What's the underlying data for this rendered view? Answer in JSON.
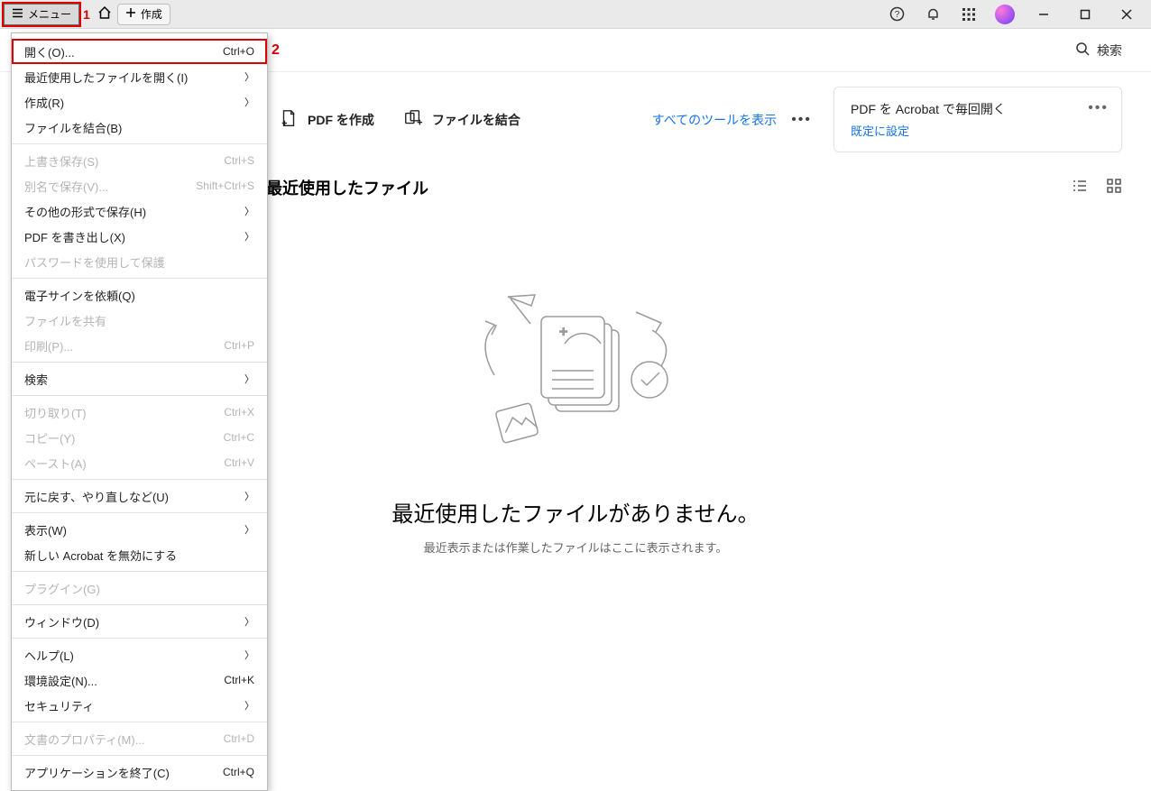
{
  "annotations": {
    "one": "1",
    "two": "2"
  },
  "titlebar": {
    "menu_label": "メニュー",
    "create_label": "作成"
  },
  "search": {
    "label": "検索"
  },
  "tools": {
    "create_pdf": "PDF を作成",
    "combine": "ファイルを結合",
    "see_all": "すべてのツールを表示"
  },
  "promo": {
    "title": "PDF を Acrobat で毎回開く",
    "action": "既定に設定"
  },
  "section": {
    "title": "最近使用したファイル"
  },
  "empty": {
    "heading": "最近使用したファイルがありません。",
    "sub": "最近表示または作業したファイルはここに表示されます。"
  },
  "menu_items": [
    {
      "label": "開く(O)...",
      "shortcut": "Ctrl+O",
      "sub": false,
      "disabled": false,
      "highlight": true
    },
    {
      "label": "最近使用したファイルを開く(I)",
      "shortcut": "",
      "sub": true,
      "disabled": false
    },
    {
      "label": "作成(R)",
      "shortcut": "",
      "sub": true,
      "disabled": false
    },
    {
      "label": "ファイルを結合(B)",
      "shortcut": "",
      "sub": false,
      "disabled": false
    },
    {
      "label": "上書き保存(S)",
      "shortcut": "Ctrl+S",
      "sub": false,
      "disabled": true
    },
    {
      "label": "別名で保存(V)...",
      "shortcut": "Shift+Ctrl+S",
      "sub": false,
      "disabled": true
    },
    {
      "label": "その他の形式で保存(H)",
      "shortcut": "",
      "sub": true,
      "disabled": false
    },
    {
      "label": "PDF を書き出し(X)",
      "shortcut": "",
      "sub": true,
      "disabled": false
    },
    {
      "label": "パスワードを使用して保護",
      "shortcut": "",
      "sub": false,
      "disabled": true
    },
    {
      "label": "電子サインを依頼(Q)",
      "shortcut": "",
      "sub": false,
      "disabled": false
    },
    {
      "label": "ファイルを共有",
      "shortcut": "",
      "sub": false,
      "disabled": true
    },
    {
      "label": "印刷(P)...",
      "shortcut": "Ctrl+P",
      "sub": false,
      "disabled": true
    },
    {
      "label": "検索",
      "shortcut": "",
      "sub": true,
      "disabled": false
    },
    {
      "label": "切り取り(T)",
      "shortcut": "Ctrl+X",
      "sub": false,
      "disabled": true
    },
    {
      "label": "コピー(Y)",
      "shortcut": "Ctrl+C",
      "sub": false,
      "disabled": true
    },
    {
      "label": "ペースト(A)",
      "shortcut": "Ctrl+V",
      "sub": false,
      "disabled": true
    },
    {
      "label": "元に戻す、やり直しなど(U)",
      "shortcut": "",
      "sub": true,
      "disabled": false
    },
    {
      "label": "表示(W)",
      "shortcut": "",
      "sub": true,
      "disabled": false
    },
    {
      "label": "新しい Acrobat を無効にする",
      "shortcut": "",
      "sub": false,
      "disabled": false
    },
    {
      "label": "プラグイン(G)",
      "shortcut": "",
      "sub": false,
      "disabled": true
    },
    {
      "label": "ウィンドウ(D)",
      "shortcut": "",
      "sub": true,
      "disabled": false
    },
    {
      "label": "ヘルプ(L)",
      "shortcut": "",
      "sub": true,
      "disabled": false
    },
    {
      "label": "環境設定(N)...",
      "shortcut": "Ctrl+K",
      "sub": false,
      "disabled": false
    },
    {
      "label": "セキュリティ",
      "shortcut": "",
      "sub": true,
      "disabled": false
    },
    {
      "label": "文書のプロパティ(M)...",
      "shortcut": "Ctrl+D",
      "sub": false,
      "disabled": true
    },
    {
      "label": "アプリケーションを終了(C)",
      "shortcut": "Ctrl+Q",
      "sub": false,
      "disabled": false
    }
  ],
  "separators_after": [
    3,
    8,
    11,
    12,
    15,
    16,
    18,
    19,
    20,
    23,
    24
  ]
}
